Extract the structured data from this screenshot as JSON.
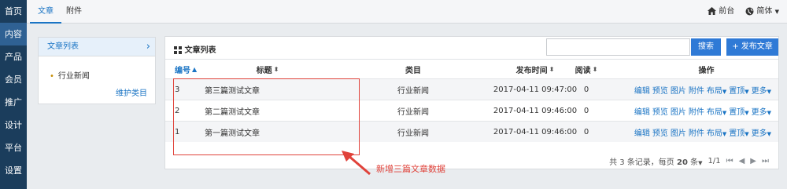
{
  "left_nav": {
    "items": [
      {
        "label": "首页",
        "active": false
      },
      {
        "label": "内容",
        "active": true
      },
      {
        "label": "产品",
        "active": false
      },
      {
        "label": "会员",
        "active": false
      },
      {
        "label": "推广",
        "active": false
      },
      {
        "label": "设计",
        "active": false
      },
      {
        "label": "平台",
        "active": false
      },
      {
        "label": "设置",
        "active": false
      }
    ]
  },
  "top_bar": {
    "tabs": [
      {
        "label": "文章",
        "active": true
      },
      {
        "label": "附件",
        "active": false
      }
    ],
    "front_label": "前台",
    "lang_label": "简体",
    "icons": {
      "front": "home-icon",
      "lang": "globe-icon"
    }
  },
  "category_panel": {
    "title": "文章列表",
    "categories": [
      "行业新闻"
    ],
    "maintain_label": "维护类目"
  },
  "article_panel": {
    "title": "文章列表",
    "search_value": "",
    "search_button": "搜索",
    "publish_button": "发布文章",
    "columns": {
      "id": "编号",
      "title": "标题",
      "category": "类目",
      "publish_time": "发布时间",
      "reads": "阅读",
      "actions": "操作"
    },
    "rows": [
      {
        "id": "3",
        "title": "第三篇测试文章",
        "category": "行业新闻",
        "publish_time": "2017-04-11 09:47:00",
        "reads": "0"
      },
      {
        "id": "2",
        "title": "第二篇测试文章",
        "category": "行业新闻",
        "publish_time": "2017-04-11 09:46:00",
        "reads": "0"
      },
      {
        "id": "1",
        "title": "第一篇测试文章",
        "category": "行业新闻",
        "publish_time": "2017-04-11 09:46:00",
        "reads": "0"
      }
    ],
    "actions": {
      "edit": "编辑",
      "preview": "预览",
      "image": "图片",
      "attachment": "附件",
      "layout": "布局",
      "pin": "置顶",
      "more": "更多"
    },
    "pager": {
      "summary_prefix": "共",
      "total": "3",
      "summary_suffix": "条记录，每页",
      "per_page": "20",
      "per_page_unit": "条",
      "page_indicator": "1/1"
    }
  },
  "annotation": {
    "text": "新增三篇文章数据",
    "color": "#e0423a"
  },
  "colors": {
    "nav_bg": "#1b3d5c",
    "nav_active": "#2f6193",
    "accent": "#1a74c4",
    "button": "#2f7ad6"
  }
}
